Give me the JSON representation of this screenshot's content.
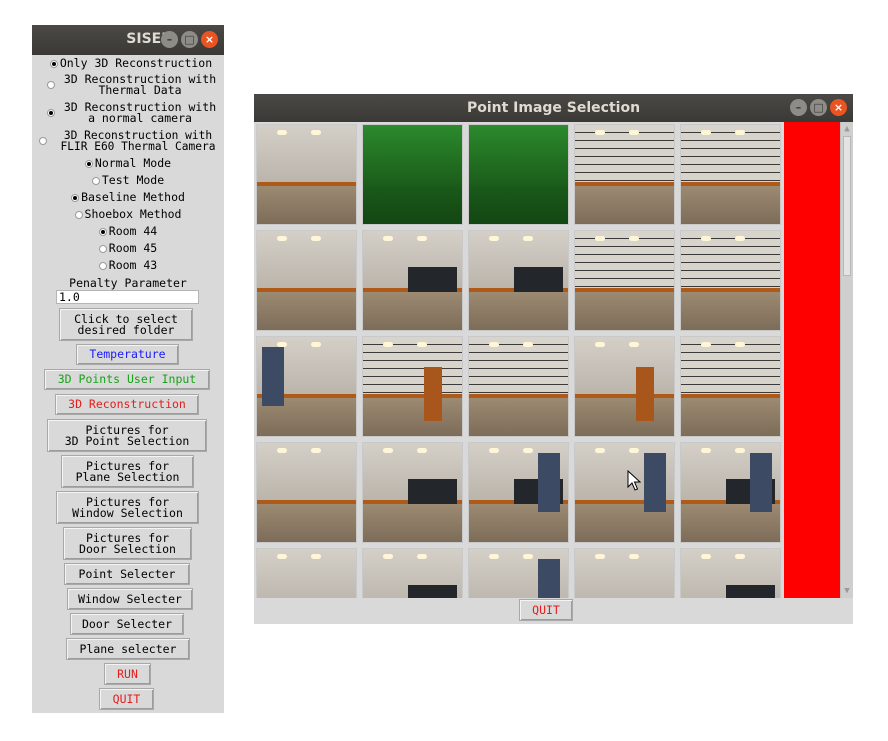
{
  "siser": {
    "title": "SISER",
    "mode_options": [
      {
        "label": "Only 3D Reconstruction",
        "selected": true
      },
      {
        "label": "3D Reconstruction with\nThermal Data",
        "selected": false
      },
      {
        "label": "3D Reconstruction with\na normal camera",
        "selected": true
      },
      {
        "label": "3D Reconstruction with\nFLIR E60 Thermal Camera",
        "selected": false
      }
    ],
    "run_modes": [
      {
        "label": "Normal Mode",
        "selected": true
      },
      {
        "label": "Test Mode",
        "selected": false
      }
    ],
    "methods": [
      {
        "label": "Baseline Method",
        "selected": true
      },
      {
        "label": "Shoebox Method",
        "selected": false
      }
    ],
    "rooms": [
      {
        "label": "Room 44",
        "selected": true
      },
      {
        "label": "Room 45",
        "selected": false
      },
      {
        "label": "Room 43",
        "selected": false
      }
    ],
    "penalty_label": "Penalty Parameter",
    "penalty_value": "1.0",
    "buttons": {
      "select_folder": "Click to select\ndesired folder",
      "temperature": "Temperature",
      "points_input": "3D Points User Input",
      "reconstruction": "3D Reconstruction",
      "pics_3d_point": "Pictures for\n3D Point Selection",
      "pics_plane": "Pictures for\nPlane Selection",
      "pics_window": "Pictures for\nWindow Selection",
      "pics_door": "Pictures for\nDoor Selection",
      "point_selecter": "Point Selecter",
      "window_selecter": "Window Selecter",
      "door_selecter": "Door Selecter",
      "plane_selecter": "Plane selecter",
      "run": "RUN",
      "quit": "QUIT"
    },
    "colors": {
      "blue": "#1a1aff",
      "green": "#17a317",
      "red": "#e51c1c"
    }
  },
  "point_image_selection": {
    "title": "Point Image Selection",
    "quit_label": "QUIT",
    "side_panel_color": "#ff0000",
    "thumbnails": [
      "room-corner-wall",
      "room-green-tinted",
      "room-green-tinted",
      "room-striped-wall",
      "room-striped-wall",
      "room-corner-wall",
      "room-blackboard",
      "room-blackboard",
      "room-striped-wall",
      "room-striped-wall",
      "room-window-wall",
      "room-striped-door",
      "room-striped-wall",
      "room-door-cabinet",
      "room-striped-wall",
      "room-corner-wall",
      "room-blackboard",
      "room-blackboard-blinds",
      "room-blinds",
      "room-blackboard-blinds",
      "room-corner-wall",
      "room-ceiling-blackboard",
      "room-ceiling-blinds",
      "room-ceiling-wall",
      "room-blackboard"
    ]
  },
  "icons": {
    "minimize": "minimize-icon",
    "maximize": "maximize-icon",
    "close": "close-icon",
    "cursor": "mouse-pointer-icon"
  }
}
